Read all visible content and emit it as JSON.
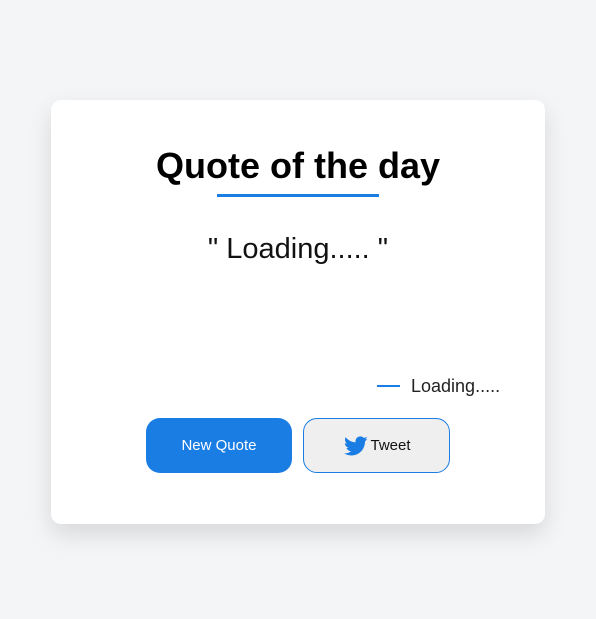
{
  "card": {
    "title": "Quote of the day",
    "quote_text": "\" Loading..... \"",
    "author_text": "Loading.....",
    "buttons": {
      "new_quote_label": "New Quote",
      "tweet_label": "Tweet",
      "tweet_icon": "twitter-icon"
    }
  },
  "colors": {
    "accent": "#1a7de3",
    "background": "#f4f5f7",
    "card": "#ffffff",
    "tweet_button_bg": "#efefef"
  }
}
